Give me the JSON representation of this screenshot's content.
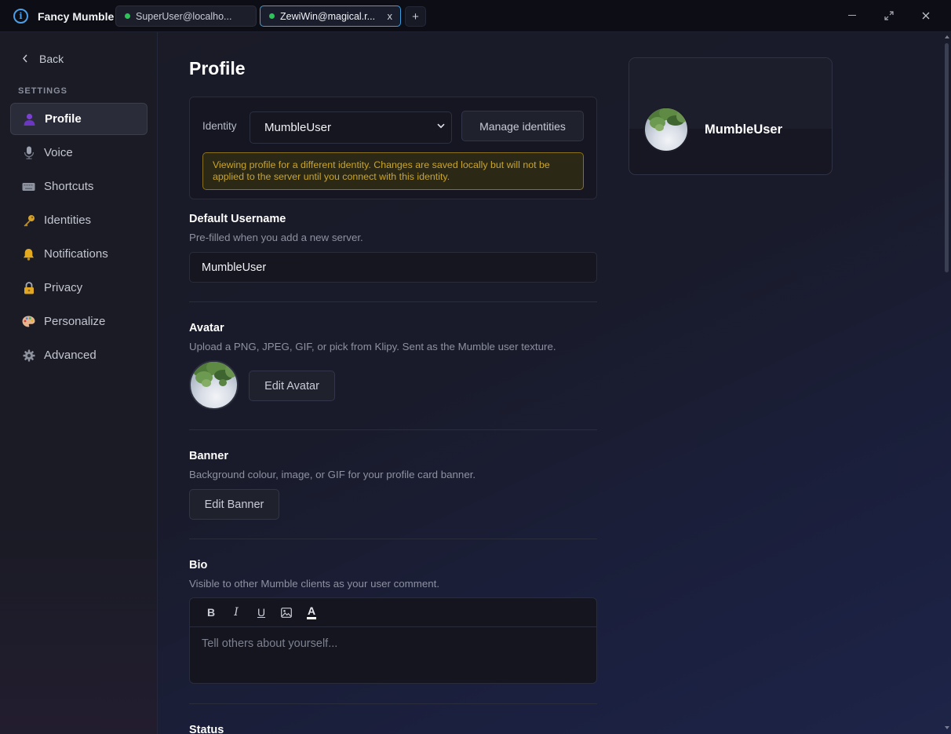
{
  "app": {
    "title": "Fancy Mumble",
    "tabs": [
      {
        "label": "SuperUser@localho...",
        "status_color": "#2fc25b",
        "active": false
      },
      {
        "label": "ZewiWin@magical.r...",
        "status_color": "#2fc25b",
        "active": true,
        "close_label": "x"
      }
    ],
    "add_tab_label": "+",
    "window_controls": {
      "minimize": "—",
      "maximize": "⤢",
      "close": "✕"
    }
  },
  "sidebar": {
    "back_label": "Back",
    "heading": "SETTINGS",
    "items": [
      {
        "label": "Profile",
        "icon": "person-icon",
        "active": true
      },
      {
        "label": "Voice",
        "icon": "microphone-icon"
      },
      {
        "label": "Shortcuts",
        "icon": "keyboard-icon"
      },
      {
        "label": "Identities",
        "icon": "key-icon"
      },
      {
        "label": "Notifications",
        "icon": "bell-icon"
      },
      {
        "label": "Privacy",
        "icon": "lock-icon"
      },
      {
        "label": "Personalize",
        "icon": "palette-icon"
      },
      {
        "label": "Advanced",
        "icon": "gear-icon"
      }
    ]
  },
  "main": {
    "title": "Profile",
    "identity": {
      "label": "Identity",
      "selected": "MumbleUser",
      "manage_label": "Manage identities",
      "warning": "Viewing profile for a different identity. Changes are saved locally but will not be applied to the server until you connect with this identity."
    },
    "default_username": {
      "title": "Default Username",
      "description": "Pre-filled when you add a new server.",
      "value": "MumbleUser"
    },
    "avatar": {
      "title": "Avatar",
      "description": "Upload a PNG, JPEG, GIF, or pick from Klipy. Sent as the Mumble user texture.",
      "edit_label": "Edit Avatar"
    },
    "banner": {
      "title": "Banner",
      "description": "Background colour, image, or GIF for your profile card banner.",
      "edit_label": "Edit Banner"
    },
    "bio": {
      "title": "Bio",
      "description": "Visible to other Mumble clients as your user comment.",
      "toolbar": {
        "bold": "B",
        "italic": "I",
        "underline": "U",
        "color": "A"
      },
      "placeholder": "Tell others about yourself..."
    },
    "status": {
      "title": "Status"
    }
  },
  "preview": {
    "name": "MumbleUser"
  },
  "colors": {
    "accent": "#3aa0e0",
    "online": "#2fc25b",
    "warning_text": "#c9a52c",
    "warning_border": "#8a7018"
  }
}
